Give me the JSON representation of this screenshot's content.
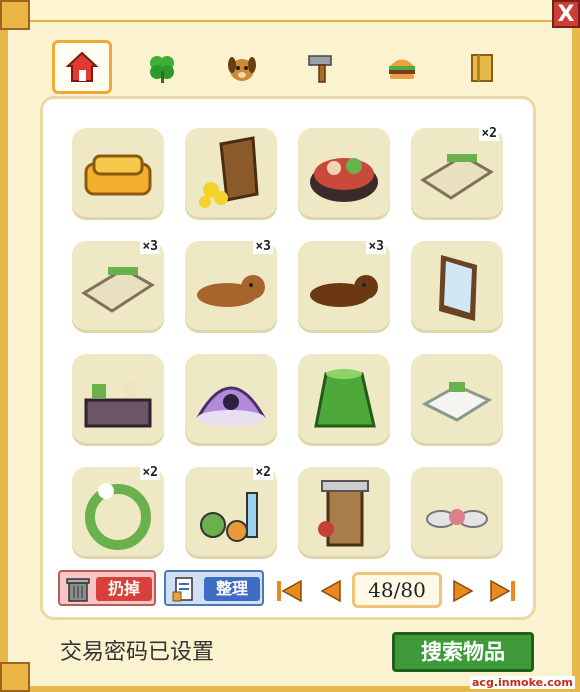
{
  "window": {
    "close_label": "X"
  },
  "tabs": [
    {
      "name": "home-icon",
      "active": true
    },
    {
      "name": "clover-icon",
      "active": false
    },
    {
      "name": "dog-face-icon",
      "active": false
    },
    {
      "name": "hammer-icon",
      "active": false
    },
    {
      "name": "burger-icon",
      "active": false
    },
    {
      "name": "book-icon",
      "active": false
    }
  ],
  "items": [
    {
      "icon": "sofa-icon",
      "qty": ""
    },
    {
      "icon": "shed-flowers-icon",
      "qty": ""
    },
    {
      "icon": "hotpot-icon",
      "qty": ""
    },
    {
      "icon": "stone-wall-icon",
      "qty": "×2"
    },
    {
      "icon": "stone-wall-icon",
      "qty": "×3"
    },
    {
      "icon": "dog-rug-icon",
      "qty": "×3"
    },
    {
      "icon": "dark-dog-rug-icon",
      "qty": "×3"
    },
    {
      "icon": "wall-mirror-icon",
      "qty": ""
    },
    {
      "icon": "display-shelf-icon",
      "qty": ""
    },
    {
      "icon": "cat-dome-icon",
      "qty": ""
    },
    {
      "icon": "hedge-bush-icon",
      "qty": ""
    },
    {
      "icon": "white-sofa-icon",
      "qty": ""
    },
    {
      "icon": "flower-wreath-icon",
      "qty": "×2"
    },
    {
      "icon": "potion-bottles-icon",
      "qty": "×2"
    },
    {
      "icon": "brick-chimney-icon",
      "qty": ""
    },
    {
      "icon": "flower-stones-icon",
      "qty": ""
    }
  ],
  "actions": {
    "discard_label": "扔掉",
    "sort_label": "整理"
  },
  "pager": {
    "current": 48,
    "total": 80,
    "display": "48/80"
  },
  "footer": {
    "status_text": "交易密码已设置",
    "search_label": "搜索物品"
  },
  "watermark": "acg.inmoke.com",
  "colors": {
    "frame": "#e9b84a",
    "slot": "#efe8c4",
    "search_button": "#3f9b3a",
    "discard_button": "#d8413a",
    "sort_button": "#3d6cc4"
  }
}
